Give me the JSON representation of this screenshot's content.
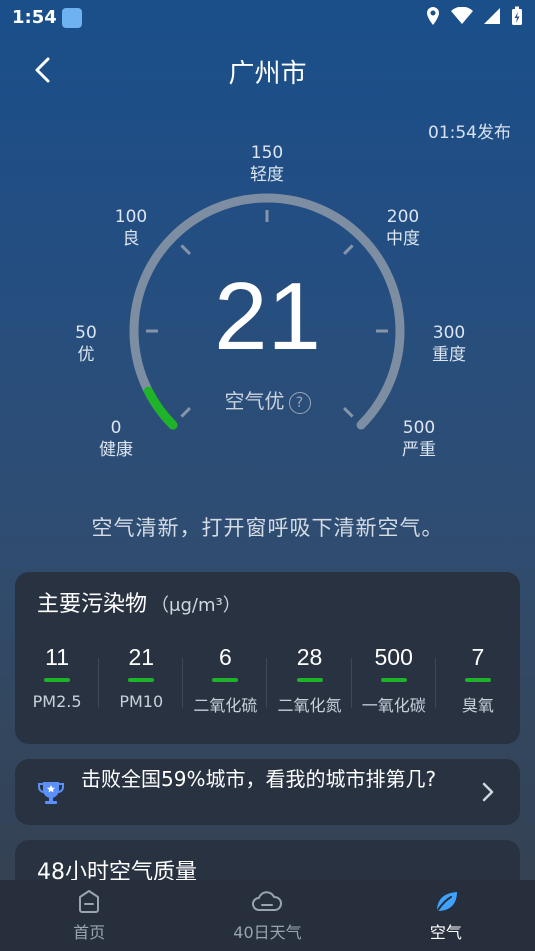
{
  "status_bar": {
    "time": "1:54"
  },
  "header": {
    "title": "广州市"
  },
  "publish_time": "01:54发布",
  "gauge": {
    "labels": [
      {
        "value": "0",
        "text": "健康"
      },
      {
        "value": "50",
        "text": "优"
      },
      {
        "value": "100",
        "text": "良"
      },
      {
        "value": "150",
        "text": "轻度"
      },
      {
        "value": "200",
        "text": "中度"
      },
      {
        "value": "300",
        "text": "重度"
      },
      {
        "value": "500",
        "text": "严重"
      }
    ],
    "aqi": "21",
    "aqi_fraction": 0.042,
    "status": "空气优",
    "help": "?",
    "progress_color": "#1fb32a",
    "track_color": "#7d8ea3"
  },
  "advice": "空气清新，打开窗呼吸下清新空气。",
  "pollutants": {
    "title": "主要污染物",
    "unit": "（μg/m³）",
    "items": [
      {
        "value": "11",
        "name": "PM2.5"
      },
      {
        "value": "21",
        "name": "PM10"
      },
      {
        "value": "6",
        "name": "二氧化硫"
      },
      {
        "value": "28",
        "name": "二氧化氮"
      },
      {
        "value": "500",
        "name": "一氧化碳"
      },
      {
        "value": "7",
        "name": "臭氧"
      }
    ]
  },
  "rank": {
    "text": "击败全国59%城市，看我的城市排第几?"
  },
  "forecast48": {
    "title": "48小时空气质量"
  },
  "tabs": [
    {
      "label": "首页",
      "icon": "home-icon"
    },
    {
      "label": "40日天气",
      "icon": "cloud-icon"
    },
    {
      "label": "空气",
      "icon": "leaf-icon"
    }
  ]
}
